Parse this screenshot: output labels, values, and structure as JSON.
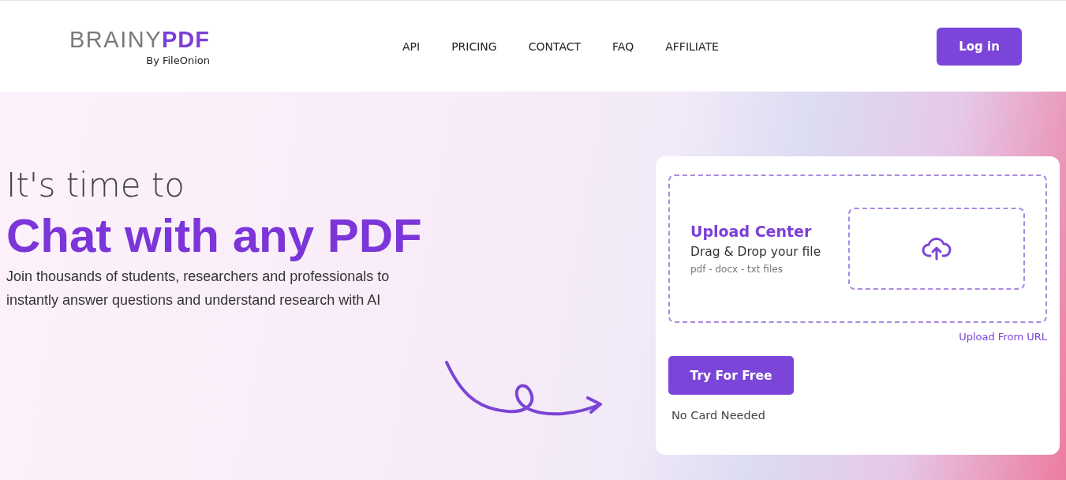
{
  "logo": {
    "brand": "BRAINY",
    "brand_accent": "PDF",
    "byline": "By FileOnion"
  },
  "nav": [
    {
      "label": "API"
    },
    {
      "label": "PRICING"
    },
    {
      "label": "CONTACT"
    },
    {
      "label": "FAQ"
    },
    {
      "label": "AFFILIATE"
    }
  ],
  "login_button": "Log in",
  "hero": {
    "kicker": "It's time to",
    "headline": "Chat with any PDF",
    "description": "Join thousands of students, researchers and professionals to instantly answer questions and understand research with AI"
  },
  "upload_card": {
    "title": "Upload Center",
    "subtitle": "Drag & Drop your file",
    "formats": "pdf - docx - txt files",
    "url_link": "Upload From URL",
    "cta": "Try For Free",
    "note": "No Card Needed"
  }
}
